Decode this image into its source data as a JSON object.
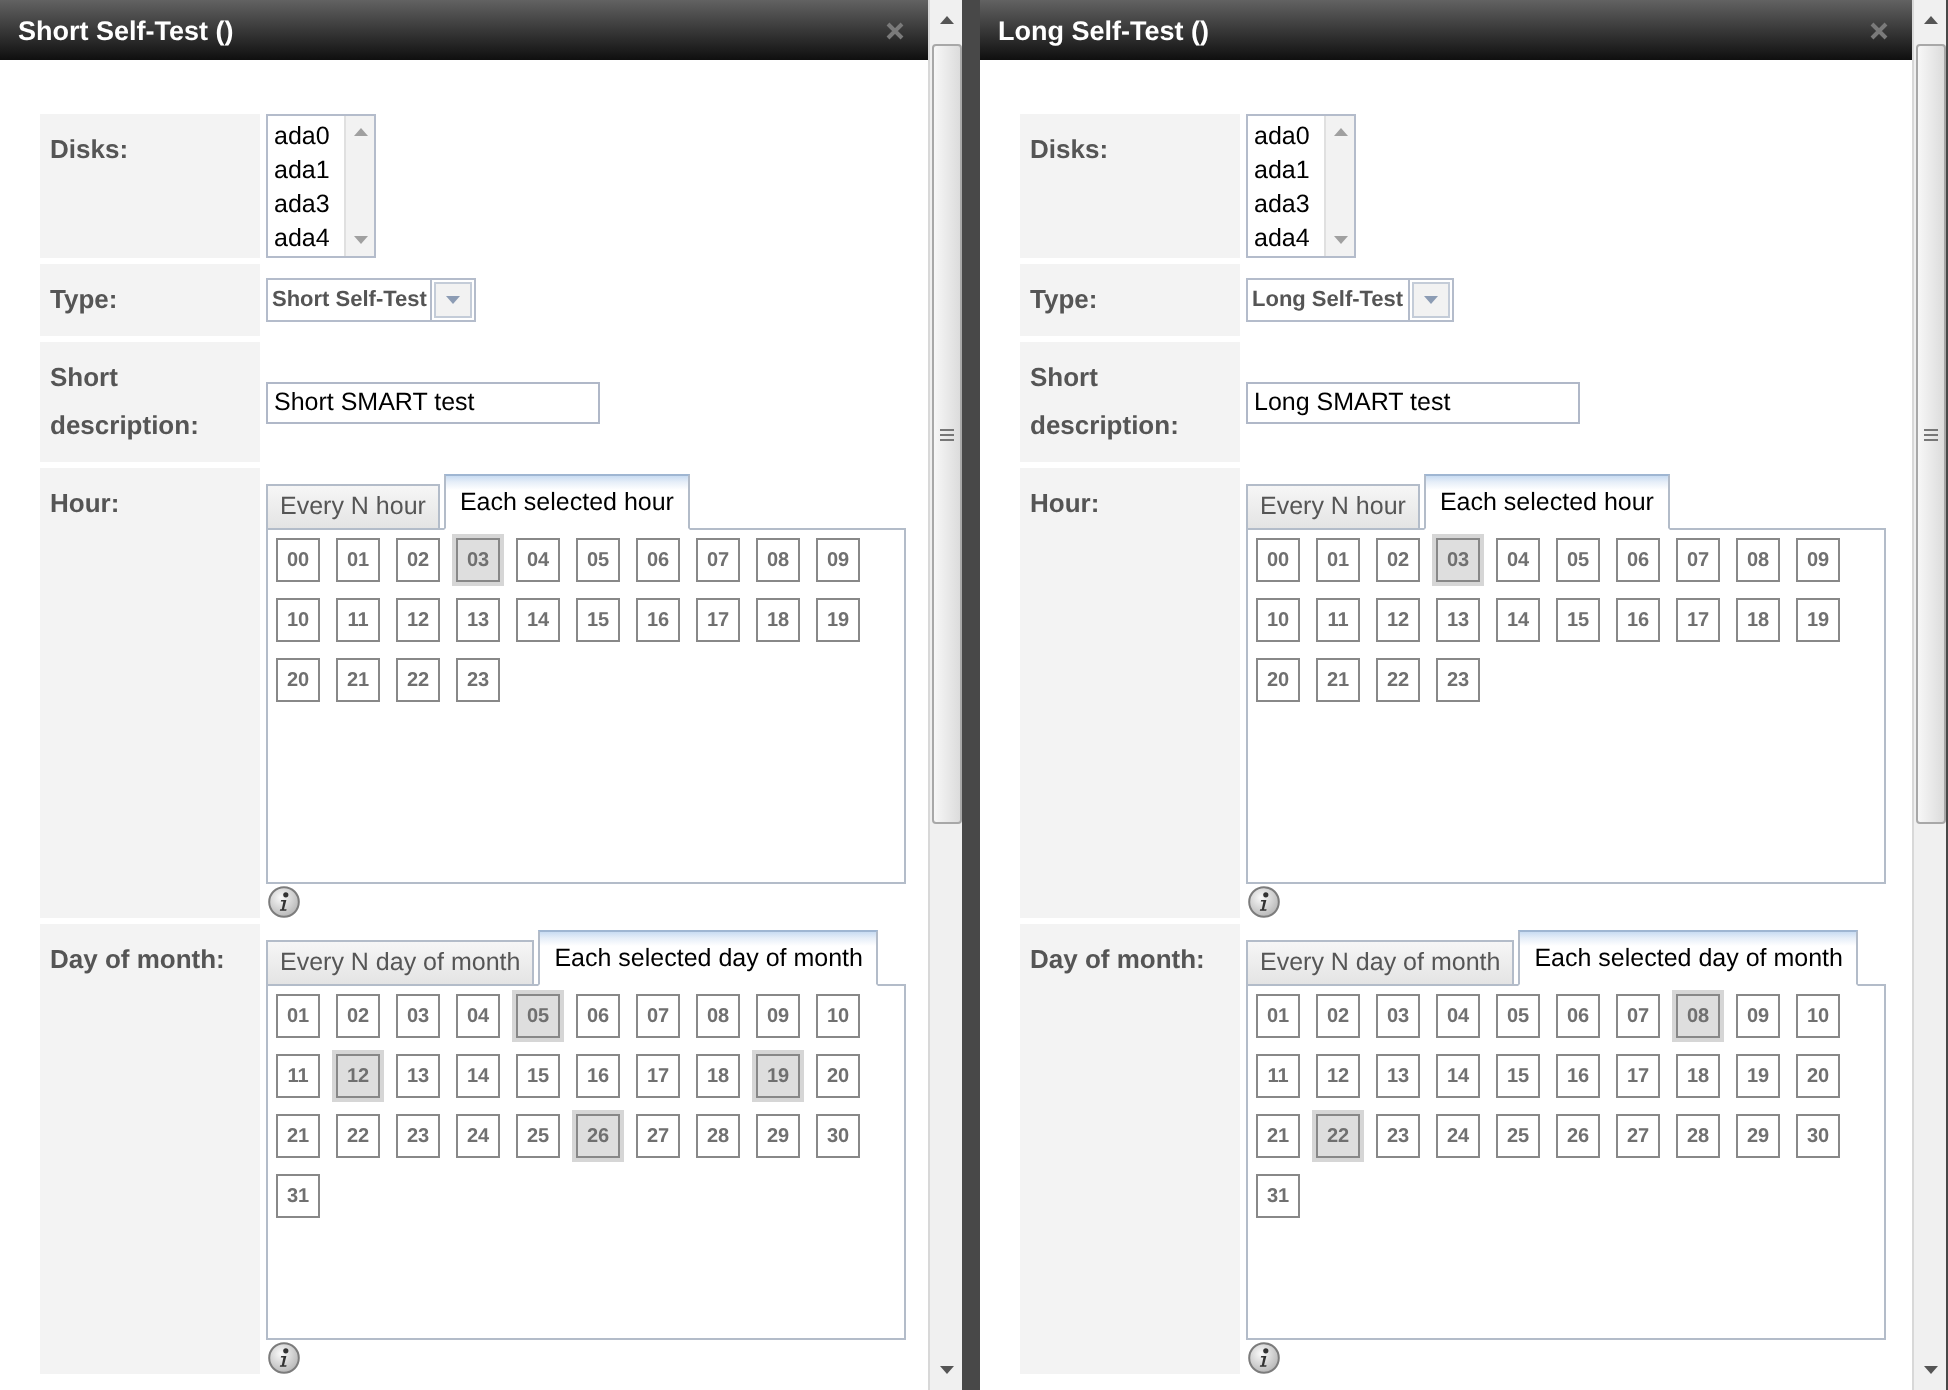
{
  "dialogs": [
    {
      "title": "Short Self-Test ()",
      "fields": [
        {
          "kind": "listbox",
          "label": "Disks:",
          "options": [
            "ada0",
            "ada1",
            "ada3",
            "ada4"
          ]
        },
        {
          "kind": "select",
          "label": "Type:",
          "value": "Short Self-Test"
        },
        {
          "kind": "text",
          "label": "Short description:",
          "value": "Short SMART test"
        },
        {
          "kind": "schedule",
          "label": "Hour:",
          "tabs": [
            {
              "label": "Every N hour",
              "selected": false
            },
            {
              "label": "Each selected hour",
              "selected": true
            }
          ],
          "cells": [
            {
              "label": "00",
              "selected": false
            },
            {
              "label": "01",
              "selected": false
            },
            {
              "label": "02",
              "selected": false
            },
            {
              "label": "03",
              "selected": true
            },
            {
              "label": "04",
              "selected": false
            },
            {
              "label": "05",
              "selected": false
            },
            {
              "label": "06",
              "selected": false
            },
            {
              "label": "07",
              "selected": false
            },
            {
              "label": "08",
              "selected": false
            },
            {
              "label": "09",
              "selected": false
            },
            {
              "label": "10",
              "selected": false
            },
            {
              "label": "11",
              "selected": false
            },
            {
              "label": "12",
              "selected": false
            },
            {
              "label": "13",
              "selected": false
            },
            {
              "label": "14",
              "selected": false
            },
            {
              "label": "15",
              "selected": false
            },
            {
              "label": "16",
              "selected": false
            },
            {
              "label": "17",
              "selected": false
            },
            {
              "label": "18",
              "selected": false
            },
            {
              "label": "19",
              "selected": false
            },
            {
              "label": "20",
              "selected": false
            },
            {
              "label": "21",
              "selected": false
            },
            {
              "label": "22",
              "selected": false
            },
            {
              "label": "23",
              "selected": false
            }
          ]
        },
        {
          "kind": "schedule",
          "label": "Day of month:",
          "tabs": [
            {
              "label": "Every N day of month",
              "selected": false
            },
            {
              "label": "Each selected day of month",
              "selected": true
            }
          ],
          "cells": [
            {
              "label": "01",
              "selected": false
            },
            {
              "label": "02",
              "selected": false
            },
            {
              "label": "03",
              "selected": false
            },
            {
              "label": "04",
              "selected": false
            },
            {
              "label": "05",
              "selected": true
            },
            {
              "label": "06",
              "selected": false
            },
            {
              "label": "07",
              "selected": false
            },
            {
              "label": "08",
              "selected": false
            },
            {
              "label": "09",
              "selected": false
            },
            {
              "label": "10",
              "selected": false
            },
            {
              "label": "11",
              "selected": false
            },
            {
              "label": "12",
              "selected": true
            },
            {
              "label": "13",
              "selected": false
            },
            {
              "label": "14",
              "selected": false
            },
            {
              "label": "15",
              "selected": false
            },
            {
              "label": "16",
              "selected": false
            },
            {
              "label": "17",
              "selected": false
            },
            {
              "label": "18",
              "selected": false
            },
            {
              "label": "19",
              "selected": true
            },
            {
              "label": "20",
              "selected": false
            },
            {
              "label": "21",
              "selected": false
            },
            {
              "label": "22",
              "selected": false
            },
            {
              "label": "23",
              "selected": false
            },
            {
              "label": "24",
              "selected": false
            },
            {
              "label": "25",
              "selected": false
            },
            {
              "label": "26",
              "selected": true
            },
            {
              "label": "27",
              "selected": false
            },
            {
              "label": "28",
              "selected": false
            },
            {
              "label": "29",
              "selected": false
            },
            {
              "label": "30",
              "selected": false
            },
            {
              "label": "31",
              "selected": false
            }
          ]
        }
      ]
    },
    {
      "title": "Long Self-Test ()",
      "fields": [
        {
          "kind": "listbox",
          "label": "Disks:",
          "options": [
            "ada0",
            "ada1",
            "ada3",
            "ada4"
          ]
        },
        {
          "kind": "select",
          "label": "Type:",
          "value": "Long Self-Test"
        },
        {
          "kind": "text",
          "label": "Short description:",
          "value": "Long SMART test"
        },
        {
          "kind": "schedule",
          "label": "Hour:",
          "tabs": [
            {
              "label": "Every N hour",
              "selected": false
            },
            {
              "label": "Each selected hour",
              "selected": true
            }
          ],
          "cells": [
            {
              "label": "00",
              "selected": false
            },
            {
              "label": "01",
              "selected": false
            },
            {
              "label": "02",
              "selected": false
            },
            {
              "label": "03",
              "selected": true
            },
            {
              "label": "04",
              "selected": false
            },
            {
              "label": "05",
              "selected": false
            },
            {
              "label": "06",
              "selected": false
            },
            {
              "label": "07",
              "selected": false
            },
            {
              "label": "08",
              "selected": false
            },
            {
              "label": "09",
              "selected": false
            },
            {
              "label": "10",
              "selected": false
            },
            {
              "label": "11",
              "selected": false
            },
            {
              "label": "12",
              "selected": false
            },
            {
              "label": "13",
              "selected": false
            },
            {
              "label": "14",
              "selected": false
            },
            {
              "label": "15",
              "selected": false
            },
            {
              "label": "16",
              "selected": false
            },
            {
              "label": "17",
              "selected": false
            },
            {
              "label": "18",
              "selected": false
            },
            {
              "label": "19",
              "selected": false
            },
            {
              "label": "20",
              "selected": false
            },
            {
              "label": "21",
              "selected": false
            },
            {
              "label": "22",
              "selected": false
            },
            {
              "label": "23",
              "selected": false
            }
          ]
        },
        {
          "kind": "schedule",
          "label": "Day of month:",
          "tabs": [
            {
              "label": "Every N day of month",
              "selected": false
            },
            {
              "label": "Each selected day of month",
              "selected": true
            }
          ],
          "cells": [
            {
              "label": "01",
              "selected": false
            },
            {
              "label": "02",
              "selected": false
            },
            {
              "label": "03",
              "selected": false
            },
            {
              "label": "04",
              "selected": false
            },
            {
              "label": "05",
              "selected": false
            },
            {
              "label": "06",
              "selected": false
            },
            {
              "label": "07",
              "selected": false
            },
            {
              "label": "08",
              "selected": true
            },
            {
              "label": "09",
              "selected": false
            },
            {
              "label": "10",
              "selected": false
            },
            {
              "label": "11",
              "selected": false
            },
            {
              "label": "12",
              "selected": false
            },
            {
              "label": "13",
              "selected": false
            },
            {
              "label": "14",
              "selected": false
            },
            {
              "label": "15",
              "selected": false
            },
            {
              "label": "16",
              "selected": false
            },
            {
              "label": "17",
              "selected": false
            },
            {
              "label": "18",
              "selected": false
            },
            {
              "label": "19",
              "selected": false
            },
            {
              "label": "20",
              "selected": false
            },
            {
              "label": "21",
              "selected": false
            },
            {
              "label": "22",
              "selected": true
            },
            {
              "label": "23",
              "selected": false
            },
            {
              "label": "24",
              "selected": false
            },
            {
              "label": "25",
              "selected": false
            },
            {
              "label": "26",
              "selected": false
            },
            {
              "label": "27",
              "selected": false
            },
            {
              "label": "28",
              "selected": false
            },
            {
              "label": "29",
              "selected": false
            },
            {
              "label": "30",
              "selected": false
            },
            {
              "label": "31",
              "selected": false
            }
          ]
        }
      ]
    }
  ]
}
